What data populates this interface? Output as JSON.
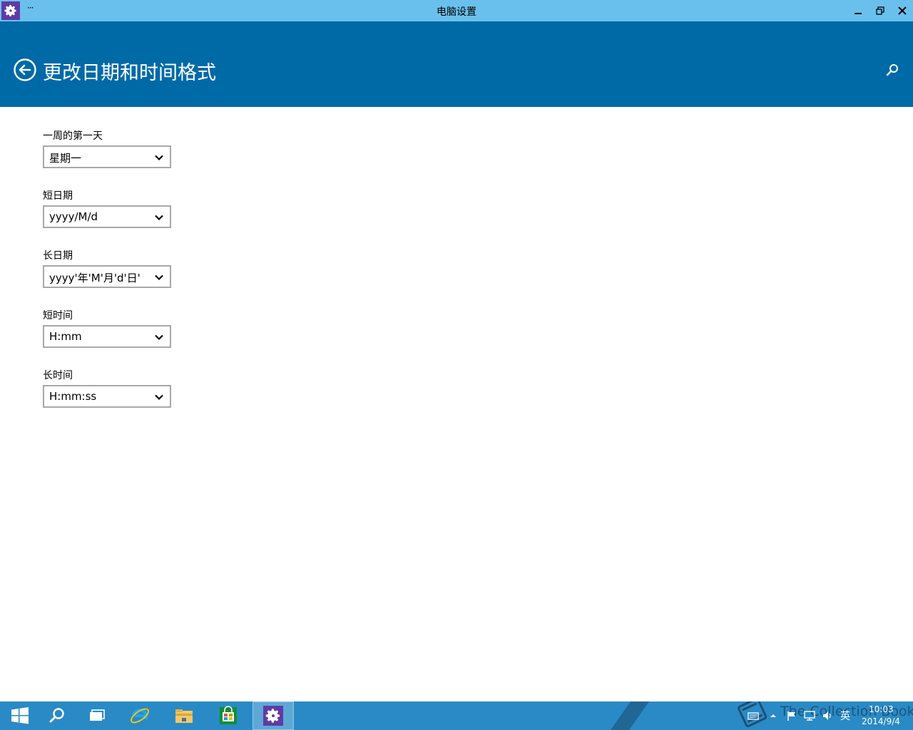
{
  "window": {
    "title": "电脑设置",
    "menu_glyph": "···",
    "controls": [
      "minimize-icon",
      "restore-icon",
      "close-icon"
    ]
  },
  "header": {
    "title": "更改日期和时间格式",
    "back_icon": "back-arrow-icon",
    "search_icon": "search-icon"
  },
  "fields": [
    {
      "label": "一周的第一天",
      "value": "星期一"
    },
    {
      "label": "短日期",
      "value": "yyyy/M/d"
    },
    {
      "label": "长日期",
      "value": "yyyy'年'M'月'd'日'"
    },
    {
      "label": "短时间",
      "value": "H:mm"
    },
    {
      "label": "长时间",
      "value": "H:mm:ss"
    }
  ],
  "taskbar": {
    "apps": [
      "start-icon",
      "search-icon",
      "task-view-icon",
      "internet-explorer-icon",
      "file-explorer-icon",
      "store-icon",
      "settings-icon"
    ],
    "active_app": "settings-icon",
    "tray": {
      "ime": "英",
      "time": "10:03",
      "date": "2014/9/4"
    },
    "watermark": "The Collection Book"
  },
  "colors": {
    "titlebar": "#6ac0ec",
    "header": "#006aa7",
    "taskbar": "#2a8ac5",
    "app_icon": "#5f3ba4"
  }
}
